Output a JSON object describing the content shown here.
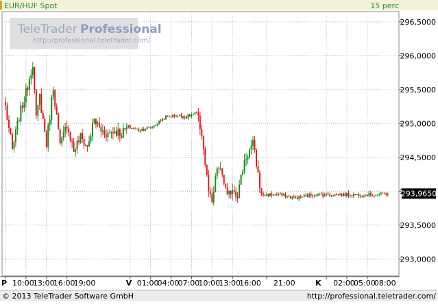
{
  "header": {
    "instrument": "EUR/HUF Spot",
    "interval": "15 perc"
  },
  "watermark": {
    "brand": "TeleTrader",
    "product": "Professional",
    "url": "http://professional.teletrader.com/"
  },
  "footer": {
    "copyright": "© 2013 TeleTrader Software GmbH",
    "url": "http://professional.teletrader.com/"
  },
  "colors": {
    "up": "#1a8c1a",
    "down": "#e01818",
    "grid": "#b8b8b8",
    "header_bg": "#f2f2d8",
    "header_text": "#2e8b2e",
    "watermark": "#9aa6c4",
    "last_price_box": "#000000"
  },
  "chart_data": {
    "type": "candlestick",
    "title": "EUR/HUF Spot",
    "interval": "15 perc",
    "y_axis": {
      "position": "right",
      "range": [
        292.75,
        296.65
      ],
      "ticks": [
        "296,5000",
        "296,0000",
        "295,5000",
        "295,0000",
        "294,5000",
        "294,0000",
        "293,5000",
        "293,0000"
      ],
      "tick_values": [
        296.5,
        296.0,
        295.5,
        295.0,
        294.5,
        294.0,
        293.5,
        293.0
      ]
    },
    "x_axis": {
      "day_markers": [
        "P",
        "V",
        "K"
      ],
      "day_marker_bar_index": [
        0,
        73,
        184
      ],
      "time_labels": [
        "10:00",
        "13:00",
        "16:00",
        "19:00",
        "01:00",
        "04:00",
        "07:00",
        "10:00",
        "13:00",
        "16:00",
        "21:00",
        "02:00",
        "05:00",
        "08:00"
      ],
      "time_label_bar_index": [
        0,
        12,
        24,
        36,
        73,
        85,
        97,
        109,
        121,
        133,
        153,
        188,
        200,
        212
      ]
    },
    "last_price": "293,9650",
    "last_price_value": 293.965,
    "grid": true,
    "bars": 225,
    "anchors_bar_index": [
      0,
      4,
      8,
      12,
      16,
      18,
      20,
      24,
      28,
      32,
      36,
      40,
      44,
      48,
      52,
      56,
      60,
      64,
      68,
      72,
      78,
      86,
      94,
      100,
      106,
      112,
      115,
      117,
      119,
      121,
      124,
      127,
      130,
      133,
      136,
      140,
      145,
      150,
      160,
      170,
      180,
      190,
      200,
      210,
      218,
      224
    ],
    "anchors_close": [
      295.25,
      294.6,
      295.1,
      295.45,
      295.9,
      295.05,
      295.4,
      294.7,
      295.55,
      294.65,
      295.0,
      294.6,
      294.8,
      294.65,
      295.05,
      294.9,
      294.85,
      294.9,
      294.85,
      294.95,
      294.9,
      294.95,
      295.1,
      295.12,
      295.1,
      295.15,
      294.85,
      294.4,
      294.0,
      293.8,
      294.35,
      294.25,
      293.9,
      294.05,
      293.95,
      294.45,
      294.7,
      293.95,
      293.95,
      293.9,
      293.95,
      293.95,
      293.95,
      293.95,
      293.95,
      293.965
    ]
  }
}
